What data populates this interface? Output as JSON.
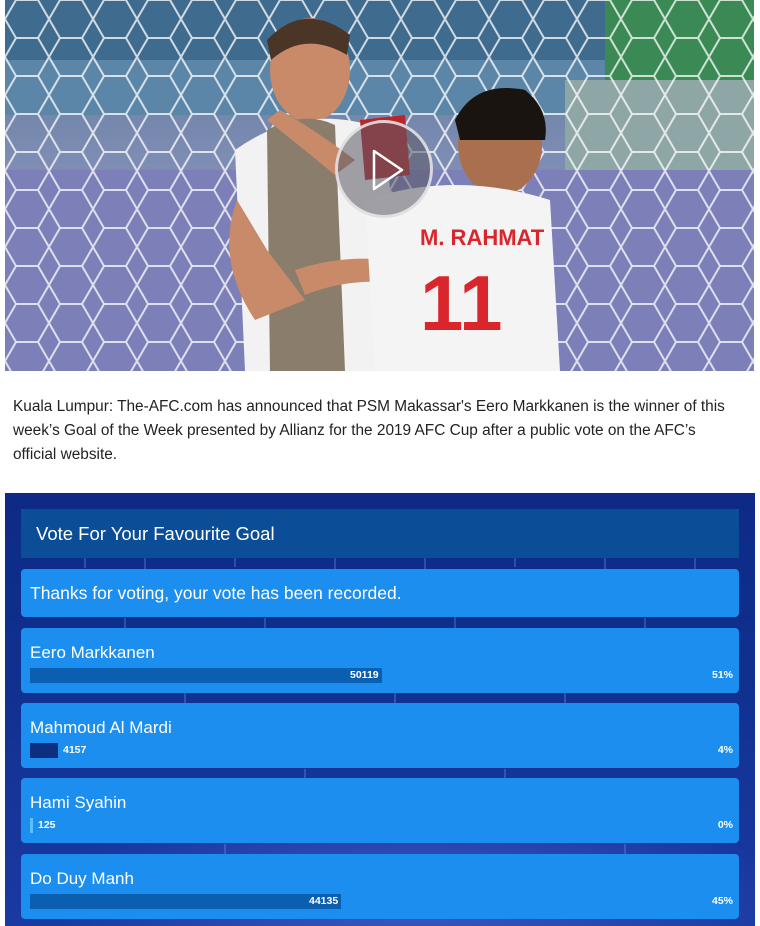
{
  "hero": {
    "jersey_name": "M. RAHMAT",
    "jersey_number": "11",
    "icons": {
      "play": "play-icon"
    }
  },
  "article": {
    "text": "Kuala Lumpur: The-AFC.com has announced that PSM Makassar's Eero Markkanen is the winner of this week’s Goal of the Week presented by Allianz for the 2019 AFC Cup after a public vote on the AFC’s official website."
  },
  "poll": {
    "title": "Vote For Your Favourite Goal",
    "message": "Thanks for voting, your vote has been recorded.",
    "options": [
      {
        "name": "Eero Markkanen",
        "votes": "50119",
        "percent": "51%",
        "share": 0.51,
        "bar_color": "#0a5fb0"
      },
      {
        "name": "Mahmoud Al Mardi",
        "votes": "4157",
        "percent": "4%",
        "share": 0.04,
        "bar_color": "#0d2f80"
      },
      {
        "name": "Hami Syahin",
        "votes": "125",
        "percent": "0%",
        "share": 0.0,
        "bar_color": "#5cc0ff"
      },
      {
        "name": "Do Duy Manh",
        "votes": "44135",
        "percent": "45%",
        "share": 0.45,
        "bar_color": "#0a5fb0"
      }
    ]
  }
}
